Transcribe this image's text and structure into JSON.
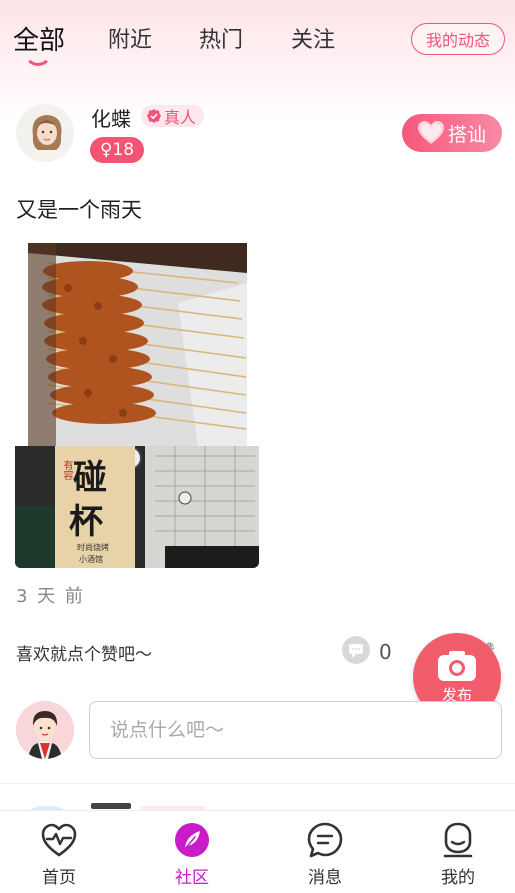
{
  "tabs": [
    {
      "label": "全部",
      "active": true
    },
    {
      "label": "附近",
      "active": false
    },
    {
      "label": "热门",
      "active": false
    },
    {
      "label": "关注",
      "active": false
    }
  ],
  "my_dynamic_label": "我的动态",
  "post": {
    "username": "化蝶",
    "verified_label": "真人",
    "gender_age": "♀18",
    "dashan_label": "搭讪",
    "text": "又是一个雨天",
    "time": "3 天 前",
    "like_prompt": "喜欢就点个赞吧～",
    "comment_count": "0",
    "like_label": "赞"
  },
  "fab_label": "发布",
  "comment_input": {
    "placeholder": "说点什么吧～"
  },
  "shop_sign": {
    "line1": "碰",
    "line2": "杯",
    "side": "有容",
    "small1": "时尚烧烤",
    "small2": "小酒馆"
  },
  "bottom_nav": [
    {
      "label": "首页",
      "icon": "heart-pulse-icon",
      "active": false
    },
    {
      "label": "社区",
      "icon": "feather-icon",
      "active": true
    },
    {
      "label": "消息",
      "icon": "chat-bubble-icon",
      "active": false
    },
    {
      "label": "我的",
      "icon": "user-face-icon",
      "active": false
    }
  ],
  "colors": {
    "accent": "#f0557a",
    "active_nav": "#c81cc9",
    "fab": "#f25d6c"
  }
}
